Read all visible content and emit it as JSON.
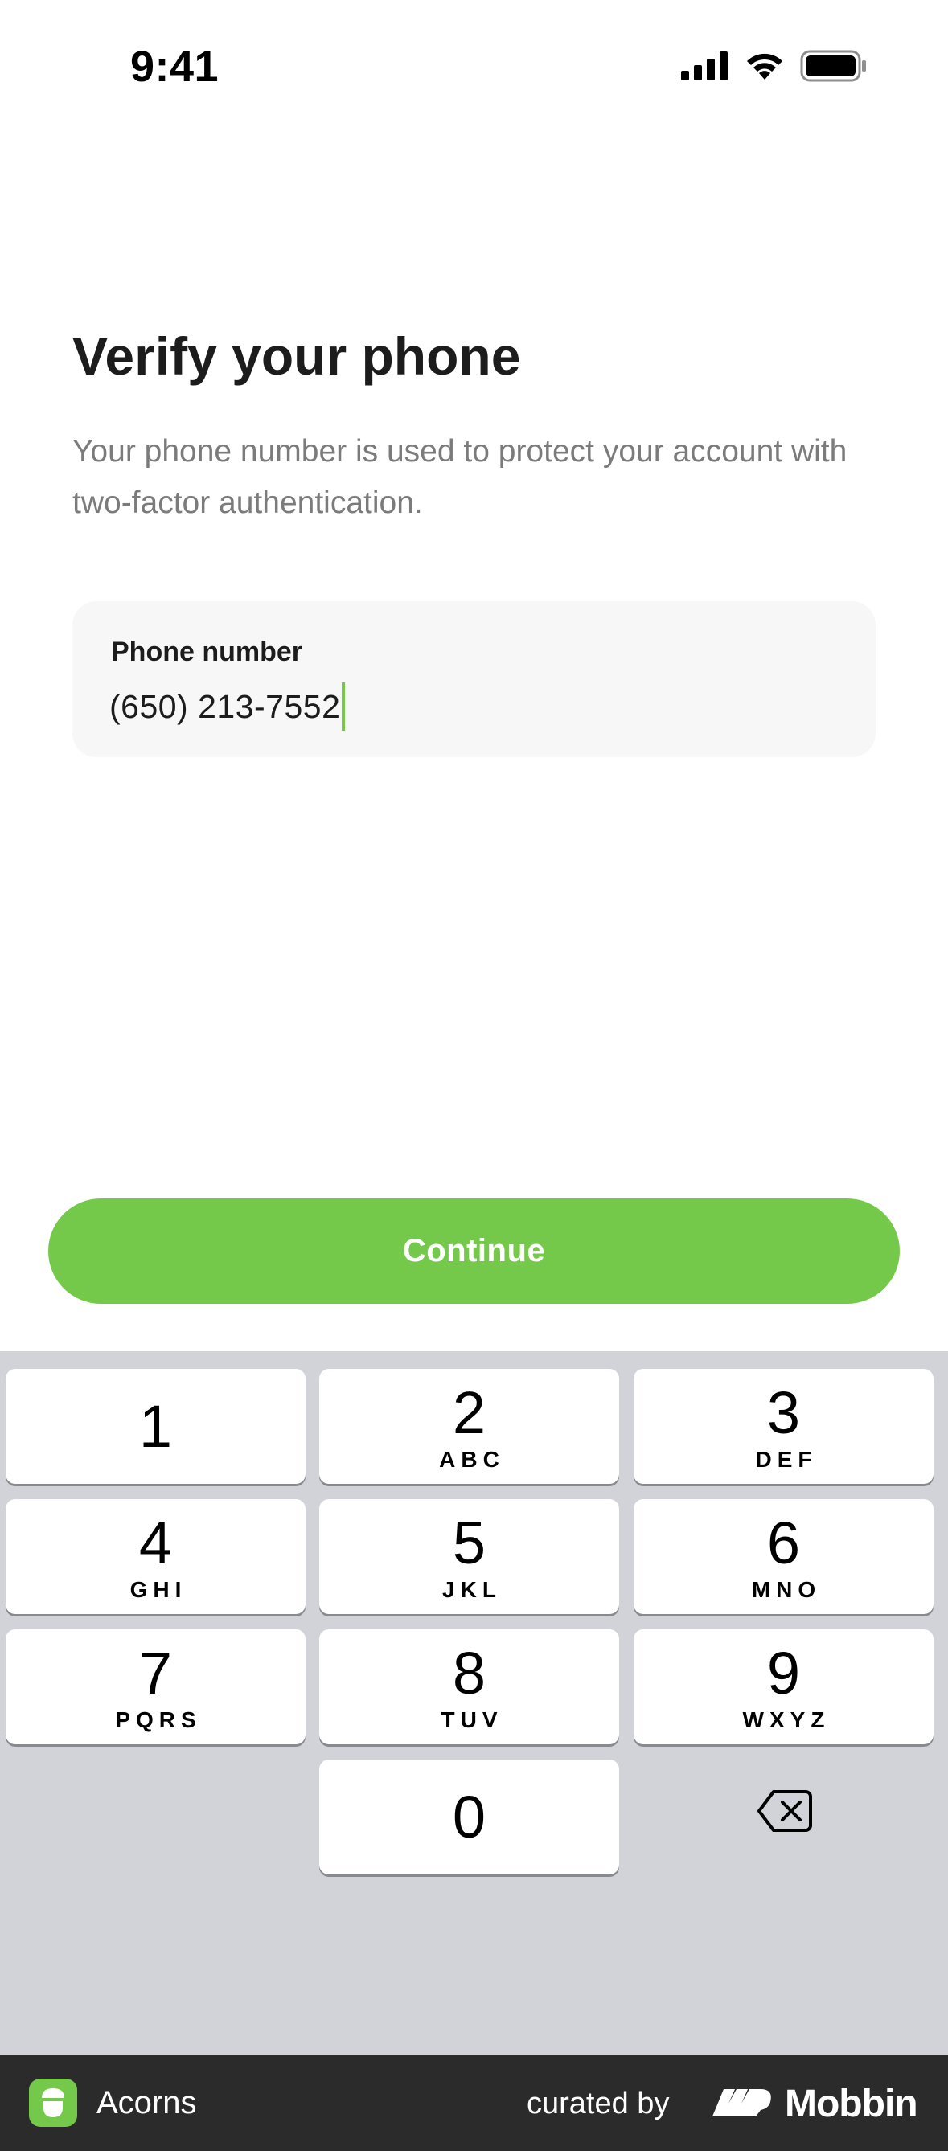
{
  "status_bar": {
    "time": "9:41",
    "icons": [
      "cellular-signal-icon",
      "wifi-icon",
      "battery-icon"
    ]
  },
  "header": {
    "title": "Verify your phone",
    "subtitle": "Your phone number is used to protect your account with two-factor authentication."
  },
  "phone_field": {
    "label": "Phone number",
    "value": "(650) 213-7552"
  },
  "continue_button": {
    "label": "Continue"
  },
  "keypad": {
    "keys": [
      {
        "num": "1",
        "letters": ""
      },
      {
        "num": "2",
        "letters": "ABC"
      },
      {
        "num": "3",
        "letters": "DEF"
      },
      {
        "num": "4",
        "letters": "GHI"
      },
      {
        "num": "5",
        "letters": "JKL"
      },
      {
        "num": "6",
        "letters": "MNO"
      },
      {
        "num": "7",
        "letters": "PQRS"
      },
      {
        "num": "8",
        "letters": "TUV"
      },
      {
        "num": "9",
        "letters": "WXYZ"
      },
      {
        "num": "0",
        "letters": ""
      }
    ],
    "delete_icon": "backspace-icon"
  },
  "footer": {
    "app_name": "Acorns",
    "curated_by": "curated by",
    "brand": "Mobbin"
  },
  "colors": {
    "accent": "#75c94a",
    "keypad_bg": "#d1d3d9",
    "footer_bg": "#2b2b2b"
  }
}
